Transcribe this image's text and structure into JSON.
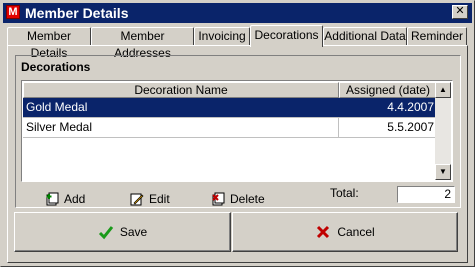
{
  "window": {
    "title": "Member Details",
    "app_icon_letter": "M",
    "close_glyph": "✕"
  },
  "tabs": [
    {
      "label": "Member Details",
      "active": false
    },
    {
      "label": "Member Addresses",
      "active": false
    },
    {
      "label": "Invoicing",
      "active": false
    },
    {
      "label": "Decorations",
      "active": true
    },
    {
      "label": "Additional Data",
      "active": false
    },
    {
      "label": "Reminder",
      "active": false
    }
  ],
  "decorations": {
    "group_title": "Decorations",
    "columns": {
      "name": "Decoration Name",
      "date": "Assigned (date)"
    },
    "rows": [
      {
        "name": "Gold Medal",
        "date": "4.4.2007",
        "selected": true
      },
      {
        "name": "Silver Medal",
        "date": "5.5.2007",
        "selected": false
      }
    ],
    "scroll_up_glyph": "▲",
    "scroll_down_glyph": "▼"
  },
  "actions": {
    "add": "Add",
    "edit": "Edit",
    "delete": "Delete"
  },
  "total": {
    "label": "Total:",
    "value": "2"
  },
  "buttons": {
    "save": "Save",
    "cancel": "Cancel"
  },
  "colors": {
    "title_bar": "#0a246a",
    "selection": "#0a246a",
    "face": "#d4d0c8",
    "save_check": "#1a9a1a",
    "cancel_x": "#c00000"
  }
}
